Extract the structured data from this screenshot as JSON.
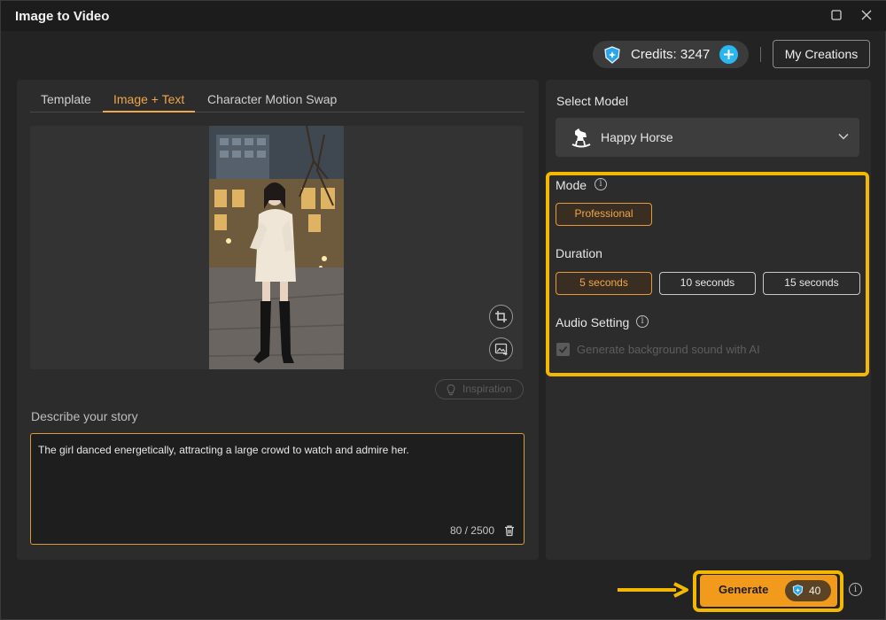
{
  "window": {
    "title": "Image to Video"
  },
  "header": {
    "credits_label": "Credits: 3247",
    "my_creations_label": "My Creations"
  },
  "tabs": [
    {
      "label": "Template",
      "active": false
    },
    {
      "label": "Image + Text",
      "active": true
    },
    {
      "label": "Character Motion Swap",
      "active": false
    }
  ],
  "preview": {
    "inspiration_label": "Inspiration"
  },
  "story": {
    "label": "Describe your story",
    "text": "The girl danced energetically, attracting a large crowd to watch and admire her.",
    "counter": "80  / 2500"
  },
  "model": {
    "label": "Select Model",
    "selected": "Happy Horse"
  },
  "mode": {
    "label": "Mode",
    "options": [
      {
        "label": "Professional",
        "selected": true
      }
    ]
  },
  "duration": {
    "label": "Duration",
    "options": [
      {
        "label": "5 seconds",
        "selected": true
      },
      {
        "label": "10 seconds",
        "selected": false
      },
      {
        "label": "15 seconds",
        "selected": false
      }
    ]
  },
  "audio": {
    "label": "Audio Setting",
    "checkbox_label": "Generate background sound with AI",
    "checked": true,
    "enabled": false
  },
  "generate": {
    "label": "Generate",
    "cost": "40"
  },
  "colors": {
    "accent": "#f29a1c",
    "highlight": "#f4b800",
    "credit_blue": "#2ab6f0",
    "selected_orange": "#f0a64a"
  }
}
